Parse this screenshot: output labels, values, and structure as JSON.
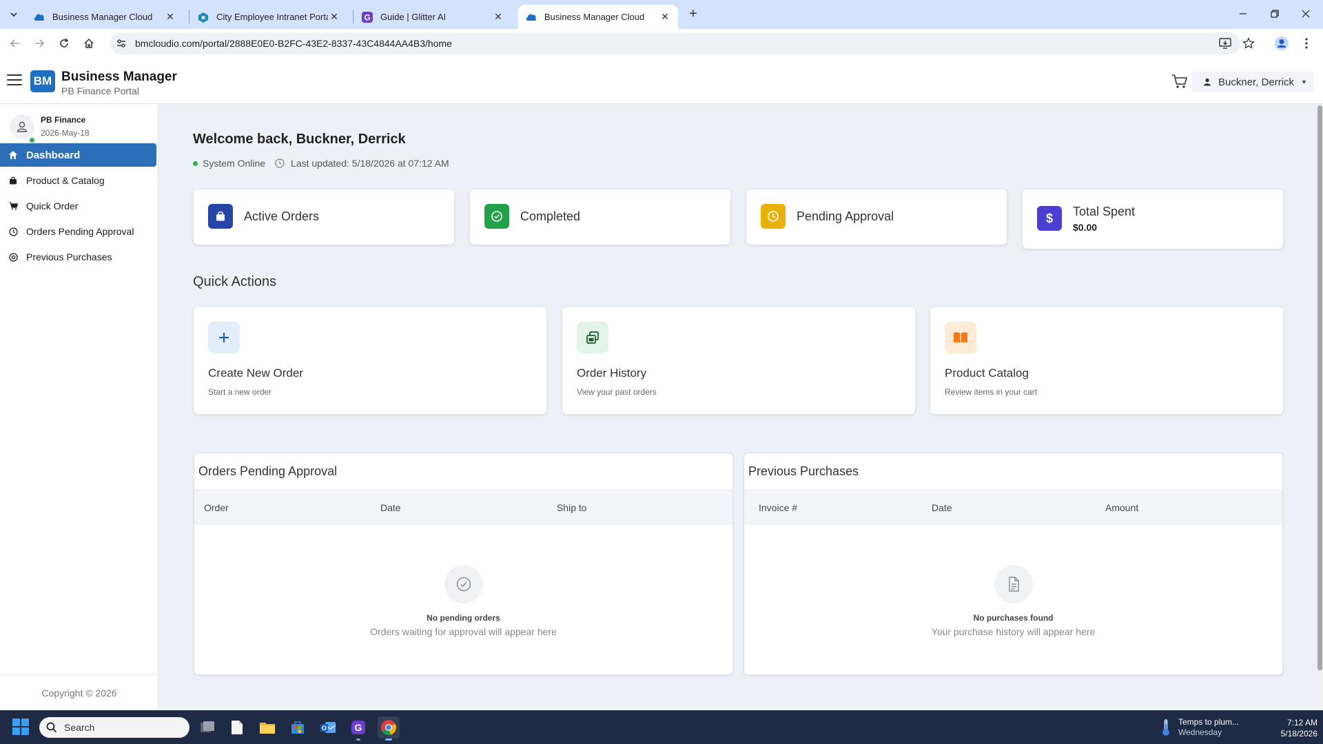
{
  "browser": {
    "tabs": [
      {
        "title": "Business Manager Cloud",
        "active": false
      },
      {
        "title": "City Employee Intranet Portal - ",
        "active": false
      },
      {
        "title": "Guide | Glitter AI",
        "active": false
      },
      {
        "title": "Business Manager Cloud",
        "active": true
      }
    ],
    "url": "bmcloudio.com/portal/2888E0E0-B2FC-43E2-8337-43C4844AA4B3/home"
  },
  "app": {
    "logo_text": "BM",
    "title": "Business Manager",
    "subtitle": "PB Finance Portal",
    "user_name": "Buckner, Derrick"
  },
  "sidebar": {
    "profile_name": "PB Finance",
    "profile_date": "2026-May-18",
    "items": [
      {
        "label": "Dashboard",
        "icon": "home-icon",
        "active": true
      },
      {
        "label": "Product & Catalog",
        "icon": "bag-icon",
        "active": false
      },
      {
        "label": "Quick Order",
        "icon": "cart-icon",
        "active": false
      },
      {
        "label": "Orders Pending Approval",
        "icon": "clock-icon",
        "active": false
      },
      {
        "label": "Previous Purchases",
        "icon": "history-icon",
        "active": false
      }
    ],
    "copyright": "Copyright © 2026"
  },
  "main": {
    "welcome": "Welcome back, Buckner, Derrick",
    "status": "System Online",
    "last_updated": "Last updated: 5/18/2026 at 07:12 AM",
    "stats": [
      {
        "label": "Active Orders",
        "icon": "shopping-bag-icon",
        "color": "#2446a8"
      },
      {
        "label": "Completed",
        "icon": "check-circle-icon",
        "color": "#23a04a"
      },
      {
        "label": "Pending Approval",
        "icon": "clock-icon",
        "color": "#e8b008"
      },
      {
        "label": "Total Spent",
        "value": "$0.00",
        "icon": "dollar-icon",
        "color": "#4c3fd6"
      }
    ],
    "quick_actions_title": "Quick Actions",
    "quick_actions": [
      {
        "title": "Create New Order",
        "desc": "Start a new order",
        "icon": "plus-icon",
        "bg": "#e3edfb"
      },
      {
        "title": "Order History",
        "desc": "View your past orders",
        "icon": "windows-stack-icon",
        "bg": "#e2f5e8"
      },
      {
        "title": "Product Catalog",
        "desc": "Review items in your cart",
        "icon": "open-book-icon",
        "bg": "#fdebd8"
      }
    ],
    "pending_panel": {
      "title": "Orders Pending Approval",
      "columns": [
        "Order",
        "Date",
        "Ship to"
      ],
      "empty_title": "No pending orders",
      "empty_sub": "Orders waiting for approval will appear here"
    },
    "purchases_panel": {
      "title": "Previous Purchases",
      "columns": [
        "Invoice #",
        "Date",
        "Amount"
      ],
      "empty_title": "No purchases found",
      "empty_sub": "Your purchase history will appear here"
    }
  },
  "taskbar": {
    "search_placeholder": "Search",
    "weather_title": "Temps to plum...",
    "weather_sub": "Wednesday",
    "time": "7:12 AM",
    "date": "5/18/2026"
  }
}
